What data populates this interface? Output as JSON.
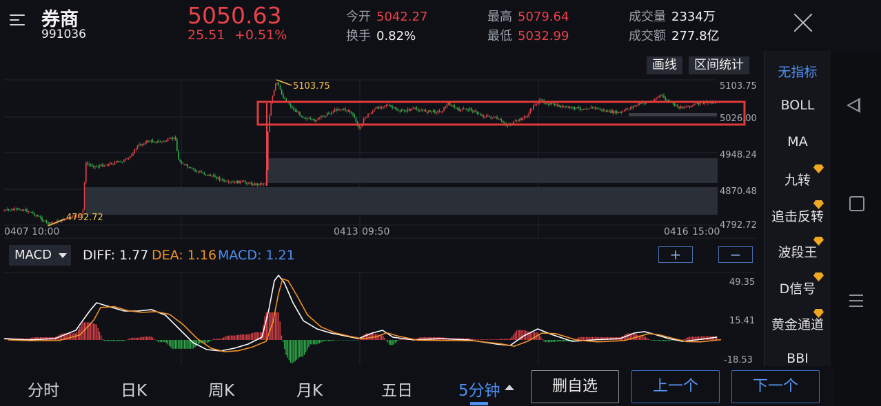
{
  "header": {
    "name": "券商",
    "code": "991036",
    "price": "5050.63",
    "change": "25.51",
    "change_pct": "+0.51%",
    "stats": [
      {
        "label": "今开",
        "value": "5042.27",
        "color": "red"
      },
      {
        "label": "换手",
        "value": "0.82%",
        "color": "white"
      },
      {
        "label": "最高",
        "value": "5079.64",
        "color": "red"
      },
      {
        "label": "最低",
        "value": "5032.99",
        "color": "red"
      },
      {
        "label": "成交量",
        "value": "2334万",
        "color": "white"
      },
      {
        "label": "成交额",
        "value": "277.8亿",
        "color": "white"
      }
    ]
  },
  "toolbar": {
    "draw_label": "画线",
    "range_label": "区间统计"
  },
  "chart_main": {
    "y_ticks": [
      "5103.75",
      "5026.00",
      "4948.24",
      "4870.48",
      "4792.72"
    ],
    "x_ticks": [
      "0407",
      "10:00",
      "0413",
      "09:50",
      "0416",
      "15:00"
    ],
    "high_label": "5103.75",
    "low_label": "4792.72"
  },
  "macd": {
    "select_label": "MACD",
    "diff": "DIFF: 1.77",
    "dea": "DEA: 1.16",
    "macd": "MACD: 1.21",
    "y_ticks": [
      "49.35",
      "15.41",
      "-18.53"
    ],
    "plus": "+",
    "minus": "−"
  },
  "indicators": [
    {
      "label": "无指标",
      "active": true,
      "vip": false
    },
    {
      "label": "BOLL",
      "active": false,
      "vip": false
    },
    {
      "label": "MA",
      "active": false,
      "vip": false
    },
    {
      "label": "九转",
      "active": false,
      "vip": true
    },
    {
      "label": "追击反转",
      "active": false,
      "vip": true
    },
    {
      "label": "波段王",
      "active": false,
      "vip": true
    },
    {
      "label": "D信号",
      "active": false,
      "vip": true
    },
    {
      "label": "黄金通道",
      "active": false,
      "vip": true
    },
    {
      "label": "BBI",
      "active": false,
      "vip": false
    }
  ],
  "tabs": [
    "分时",
    "日K",
    "周K",
    "月K",
    "五日",
    "5分钟"
  ],
  "active_tab": "5分钟",
  "buttons": {
    "remove_watch": "删自选",
    "prev": "上一个",
    "next": "下一个"
  },
  "colors": {
    "up": "#e8424a",
    "down": "#2fb34a",
    "accent": "#4d8ff0",
    "dea": "#f0922a",
    "highlight_box": "#e03a3a"
  }
}
